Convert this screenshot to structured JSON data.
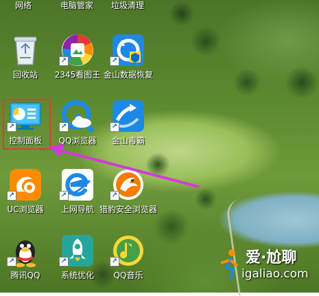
{
  "top_labels": [
    "网络",
    "电脑管家",
    "垃圾清理"
  ],
  "icons": [
    {
      "label": "回收站",
      "icon": "recycle-bin-icon",
      "shortcut": false
    },
    {
      "label": "2345看图王",
      "icon": "image-viewer-2345-icon",
      "shortcut": true
    },
    {
      "label": "金山数据恢复",
      "icon": "kingsoft-data-recovery-icon",
      "shortcut": true
    },
    {
      "label": "控制面板",
      "icon": "control-panel-icon",
      "shortcut": true,
      "selected": true
    },
    {
      "label": "QQ浏览器",
      "icon": "qq-browser-icon",
      "shortcut": true
    },
    {
      "label": "金山毒霸",
      "icon": "kingsoft-antivirus-icon",
      "shortcut": true
    },
    {
      "label": "UC浏览器",
      "icon": "uc-browser-icon",
      "shortcut": true
    },
    {
      "label": "上网导航",
      "icon": "ie-navigation-icon",
      "shortcut": true
    },
    {
      "label": "猎豹安全浏览器",
      "icon": "cheetah-browser-icon",
      "shortcut": true
    },
    {
      "label": "腾讯QQ",
      "icon": "tencent-qq-icon",
      "shortcut": true
    },
    {
      "label": "系统优化",
      "icon": "system-optimize-icon",
      "shortcut": true
    },
    {
      "label": "QQ音乐",
      "icon": "qq-music-icon",
      "shortcut": true
    }
  ],
  "watermark": {
    "line1": "爱·尬聊",
    "line2": "igaliao.com"
  },
  "colors": {
    "highlight_border": "#e53935",
    "arrow": "#d23bd8"
  }
}
